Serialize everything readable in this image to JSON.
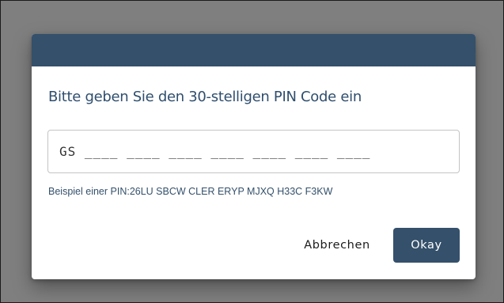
{
  "dialog": {
    "title": "Bitte geben Sie den 30-stelligen PIN Code ein",
    "pin_input": {
      "value": "GS ____ ____ ____ ____ ____ ____ ____"
    },
    "hint": "Beispiel einer PIN:26LU SBCW CLER ERYP MJXQ H33C F3KW",
    "buttons": {
      "cancel_label": "Abbrechen",
      "okay_label": "Okay"
    }
  },
  "colors": {
    "header": "#34506b",
    "title_text": "#2f4e6e",
    "primary_button": "#34506b",
    "backdrop": "#7f7f7f"
  }
}
